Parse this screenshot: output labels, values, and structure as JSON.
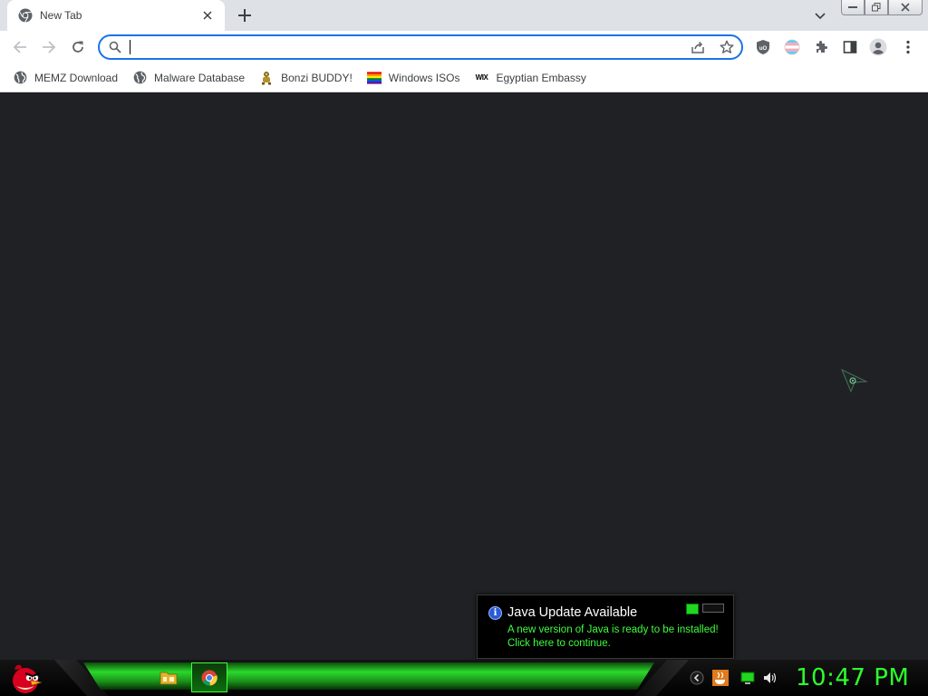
{
  "browser": {
    "tab": {
      "title": "New Tab",
      "favicon": "chrome-icon"
    },
    "omnibox": {
      "value": "",
      "placeholder": ""
    },
    "bookmarks": [
      {
        "label": "MEMZ Download",
        "icon": "globe-icon"
      },
      {
        "label": "Malware Database",
        "icon": "globe-icon"
      },
      {
        "label": "Bonzi BUDDY!",
        "icon": "bonzi-icon"
      },
      {
        "label": "Windows ISOs",
        "icon": "rainbow-flag-icon"
      },
      {
        "label": "Egyptian Embassy",
        "icon": "wix-icon"
      }
    ],
    "wix_icon_text": "WIX"
  },
  "notification": {
    "title": "Java Update Available",
    "line1": "A new version of Java is ready to be installed!",
    "line2": "Click here to continue.",
    "info_glyph": "i"
  },
  "taskbar": {
    "clock": "10:47 PM",
    "accent": "#2cff2c"
  },
  "colors": {
    "content_bg": "#202124",
    "tabstrip_bg": "#dee1e6",
    "omnibox_border": "#1a73e8"
  }
}
